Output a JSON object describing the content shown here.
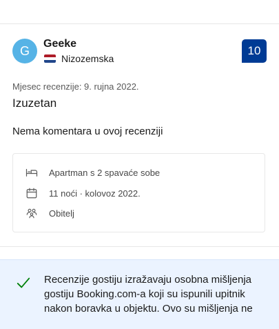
{
  "reviewer": {
    "avatar_letter": "G",
    "name": "Geeke",
    "country": "Nizozemska",
    "flag_colors": [
      "#ae1c28",
      "#ffffff",
      "#21468b"
    ],
    "score": "10"
  },
  "review": {
    "date": "Mjesec recenzije: 9. rujna 2022.",
    "title": "Izuzetan",
    "body": "Nema komentara u ovoj recenziji"
  },
  "stay": {
    "room": "Apartman s 2 spavaće sobe",
    "nights": "11 noći · kolovoz 2022.",
    "traveler_type": "Obitelj",
    "icons": [
      "bed-icon",
      "calendar-icon",
      "group-icon"
    ]
  },
  "info": {
    "text": "Recenzije gostiju izražavaju osobna mišljenja gostiju Booking.com-a koji su ispunili upitnik nakon boravka u objektu. Ovo su mišljenja ne",
    "accent_color": "#008009"
  },
  "colors": {
    "score_bg": "#003b95",
    "avatar_bg": "#56b3e6",
    "info_bg": "#ebf3ff"
  }
}
